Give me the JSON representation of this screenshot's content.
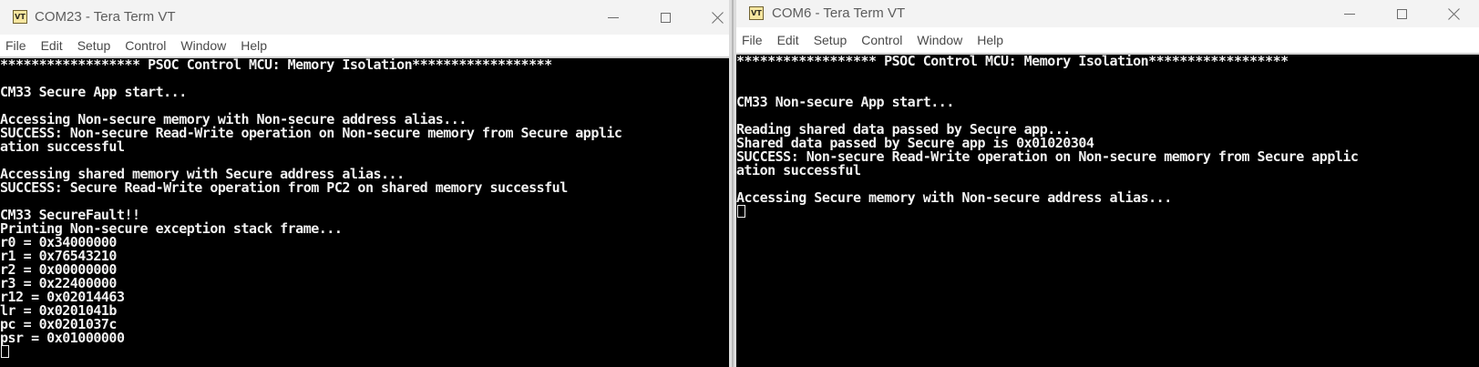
{
  "left_window": {
    "title": "COM23 - Tera Term VT",
    "icon_text": "VT",
    "menu": [
      "File",
      "Edit",
      "Setup",
      "Control",
      "Window",
      "Help"
    ],
    "lines": [
      "****************** PSOC Control MCU: Memory Isolation******************",
      "",
      "CM33 Secure App start...",
      "",
      "Accessing Non-secure memory with Non-secure address alias...",
      "SUCCESS: Non-secure Read-Write operation on Non-secure memory from Secure applic",
      "ation successful",
      "",
      "Accessing shared memory with Secure address alias...",
      "SUCCESS: Secure Read-Write operation from PC2 on shared memory successful",
      "",
      "CM33 SecureFault!!",
      "Printing Non-secure exception stack frame...",
      "r0 = 0x34000000",
      "r1 = 0x76543210",
      "r2 = 0x00000000",
      "r3 = 0x22400000",
      "r12 = 0x02014463",
      "lr = 0x0201041b",
      "pc = 0x0201037c",
      "psr = 0x01000000"
    ]
  },
  "right_window": {
    "title": "COM6 - Tera Term VT",
    "icon_text": "VT",
    "menu": [
      "File",
      "Edit",
      "Setup",
      "Control",
      "Window",
      "Help"
    ],
    "lines": [
      "****************** PSOC Control MCU: Memory Isolation******************",
      "",
      "",
      "CM33 Non-secure App start...",
      "",
      "Reading shared data passed by Secure app...",
      "Shared data passed by Secure app is 0x01020304",
      "SUCCESS: Non-secure Read-Write operation on Non-secure memory from Secure applic",
      "ation successful",
      "",
      "Accessing Secure memory with Non-secure address alias..."
    ]
  }
}
